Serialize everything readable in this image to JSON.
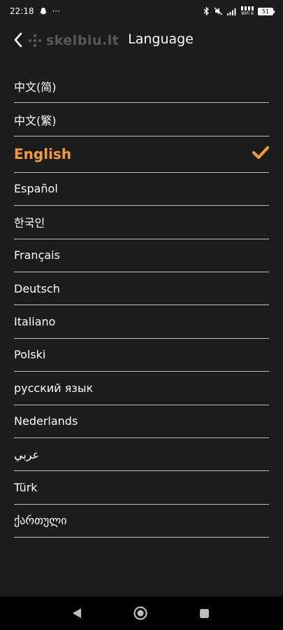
{
  "status_bar": {
    "time": "22:18",
    "more": "···",
    "wifi_label": "WiFi 6",
    "battery": "51"
  },
  "header": {
    "logo_text": "skelbiu.lt",
    "title": "Language"
  },
  "languages": [
    {
      "label": "中文(简)",
      "selected": false
    },
    {
      "label": "中文(繁)",
      "selected": false
    },
    {
      "label": "English",
      "selected": true
    },
    {
      "label": "Español",
      "selected": false
    },
    {
      "label": "한국인",
      "selected": false
    },
    {
      "label": "Français",
      "selected": false
    },
    {
      "label": "Deutsch",
      "selected": false
    },
    {
      "label": "Italiano",
      "selected": false
    },
    {
      "label": "Polski",
      "selected": false
    },
    {
      "label": "русский язык",
      "selected": false
    },
    {
      "label": "Nederlands",
      "selected": false
    },
    {
      "label": "عربي",
      "selected": false
    },
    {
      "label": "Türk",
      "selected": false
    },
    {
      "label": "ქართული",
      "selected": false
    }
  ],
  "colors": {
    "background": "#1c1c1c",
    "accent": "#f39c33",
    "divider": "#bdbdbd",
    "nav_bar": "#000000"
  },
  "icons": {
    "back": "chevron-left-icon",
    "check": "checkmark-icon",
    "nav_back": "triangle-back-icon",
    "nav_home": "circle-home-icon",
    "nav_recents": "square-recents-icon"
  }
}
